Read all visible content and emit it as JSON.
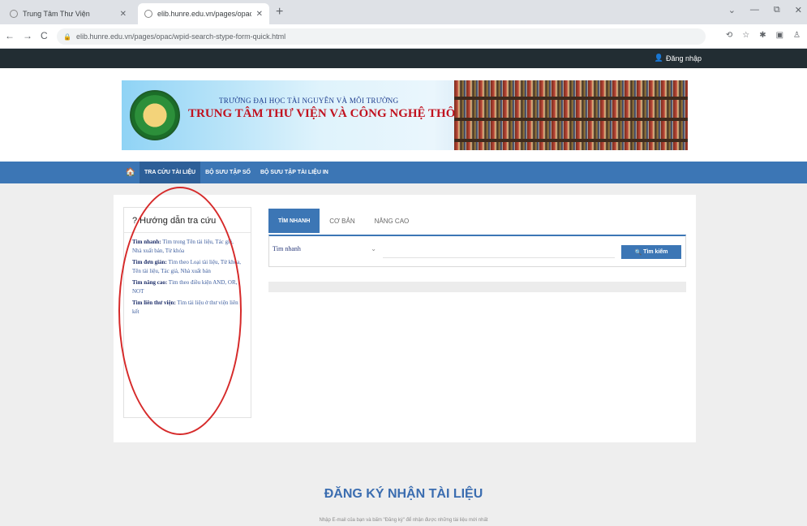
{
  "browser": {
    "tabs": [
      {
        "title": "Trung Tâm Thư Viện"
      },
      {
        "title": "elib.hunre.edu.vn/pages/opac/c..."
      }
    ],
    "new_tab": "+",
    "window_controls": [
      "⌄",
      "—",
      "⧉",
      "✕"
    ],
    "nav_buttons": [
      "←",
      "→",
      "C"
    ],
    "url": "elib.hunre.edu.vn/pages/opac/wpid-search-stype-form-quick.html",
    "extension_icons": [
      "⟲",
      "☆",
      "✱",
      "▣",
      "♙"
    ]
  },
  "topbar": {
    "login_label": "Đăng nhập"
  },
  "banner": {
    "subtitle": "TRƯỜNG ĐẠI HỌC TÀI NGUYÊN VÀ MÔI TRƯỜNG",
    "title": "TRUNG TÂM THƯ VIỆN VÀ CÔNG NGHỆ THÔNG TIN"
  },
  "nav": {
    "home_icon": "home-icon",
    "items": [
      "TRA CỨU TÀI LIỆU",
      "BỘ SƯU TẬP SỐ",
      "BỘ SƯU TẬP TÀI LIỆU IN"
    ]
  },
  "guide": {
    "title": "Hướng dẫn tra cứu",
    "items": [
      {
        "label": "Tìm nhanh:",
        "text": "Tìm trong Tên tài liệu, Tác giả, Nhà xuất bản, Từ khóa"
      },
      {
        "label": "Tìm đơn giản:",
        "text": "Tìm theo Loại tài liệu, Từ khóa, Tên tài liệu, Tác giả, Nhà xuất bản"
      },
      {
        "label": "Tìm nâng cao:",
        "text": "Tìm theo điều kiện AND, OR, NOT"
      },
      {
        "label": "Tìm liên thư viện:",
        "text": "Tìm tài liệu ở thư viện liên kết"
      }
    ]
  },
  "search": {
    "tabs": [
      "TÌM NHANH",
      "CƠ BẢN",
      "NÂNG CAO"
    ],
    "field_selected": "Tìm nhanh",
    "button_label": "Tìm kiếm"
  },
  "register": {
    "title": "ĐĂNG KÝ NHẬN TÀI LIỆU",
    "subtitle": "Nhập E-mail của bạn và bấm \"Đăng ký\" để nhận được những tài liệu mới nhất"
  }
}
